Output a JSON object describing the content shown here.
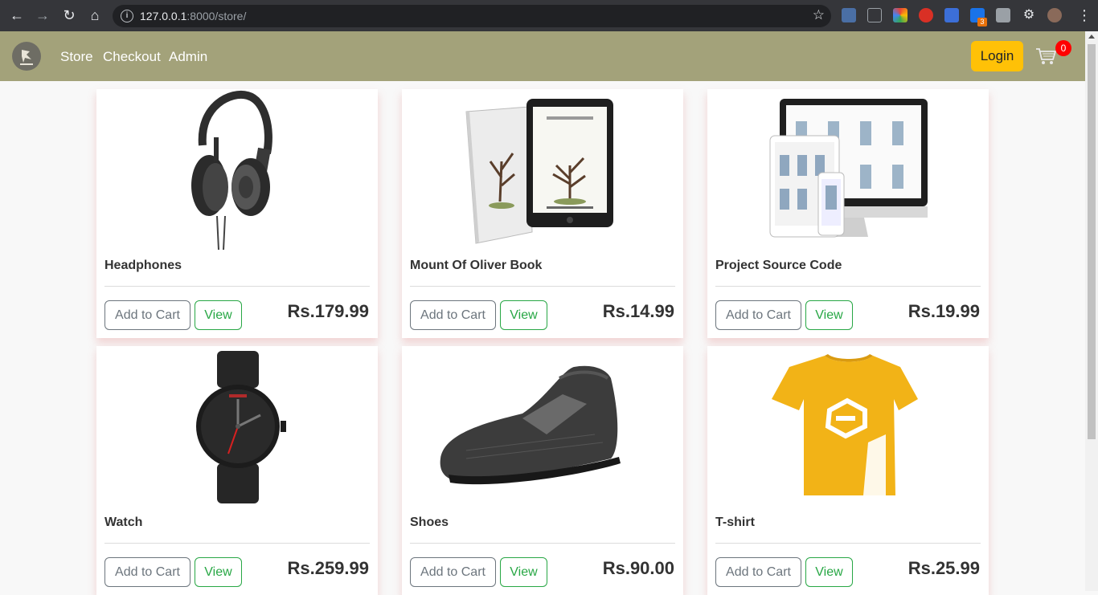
{
  "browser": {
    "url_host": "127.0.0.1",
    "url_rest": ":8000/store/",
    "extension_badge": "3"
  },
  "navbar": {
    "links": [
      "Store",
      "Checkout",
      "Admin"
    ],
    "login_label": "Login",
    "cart_count": "0"
  },
  "products": [
    {
      "name": "Headphones",
      "price": "Rs.179.99",
      "add_label": "Add to Cart",
      "view_label": "View",
      "image": "headphones"
    },
    {
      "name": "Mount Of Oliver Book",
      "price": "Rs.14.99",
      "add_label": "Add to Cart",
      "view_label": "View",
      "image": "book"
    },
    {
      "name": "Project Source Code",
      "price": "Rs.19.99",
      "add_label": "Add to Cart",
      "view_label": "View",
      "image": "devices"
    },
    {
      "name": "Watch",
      "price": "Rs.259.99",
      "add_label": "Add to Cart",
      "view_label": "View",
      "image": "watch"
    },
    {
      "name": "Shoes",
      "price": "Rs.90.00",
      "add_label": "Add to Cart",
      "view_label": "View",
      "image": "shoe"
    },
    {
      "name": "T-shirt",
      "price": "Rs.25.99",
      "add_label": "Add to Cart",
      "view_label": "View",
      "image": "tshirt"
    }
  ],
  "colors": {
    "navbar": "#a3a27a",
    "login": "#ffc107",
    "view_button": "#28a745",
    "add_button": "#6c757d",
    "cart_badge": "#ff0000"
  }
}
